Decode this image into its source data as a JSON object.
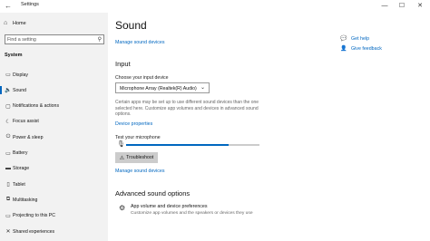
{
  "window": {
    "title": "Settings",
    "back_glyph": "←",
    "controls": {
      "minimize": "—",
      "maximize": "☐",
      "close": "✕"
    }
  },
  "sidebar": {
    "home_label": "Home",
    "search_placeholder": "Find a setting",
    "section_title": "System",
    "items": [
      {
        "label": "Display",
        "icon": "display-icon",
        "glyph": "▭",
        "active": false
      },
      {
        "label": "Sound",
        "icon": "speaker-icon",
        "glyph": "🔈",
        "active": true
      },
      {
        "label": "Notifications & actions",
        "icon": "notifications-icon",
        "glyph": "▢",
        "active": false
      },
      {
        "label": "Focus assist",
        "icon": "focus-assist-icon",
        "glyph": "☾",
        "active": false
      },
      {
        "label": "Power & sleep",
        "icon": "power-icon",
        "glyph": "⏻",
        "active": false
      },
      {
        "label": "Battery",
        "icon": "battery-icon",
        "glyph": "▭",
        "active": false
      },
      {
        "label": "Storage",
        "icon": "storage-icon",
        "glyph": "▬",
        "active": false
      },
      {
        "label": "Tablet",
        "icon": "tablet-icon",
        "glyph": "▯",
        "active": false
      },
      {
        "label": "Multitasking",
        "icon": "multitasking-icon",
        "glyph": "⧉",
        "active": false
      },
      {
        "label": "Projecting to this PC",
        "icon": "projecting-icon",
        "glyph": "▭",
        "active": false
      },
      {
        "label": "Shared experiences",
        "icon": "shared-experiences-icon",
        "glyph": "✕",
        "active": false
      }
    ]
  },
  "main": {
    "title": "Sound",
    "manage_sound_devices_top": "Manage sound devices",
    "input_heading": "Input",
    "choose_input_label": "Choose your input device",
    "input_device_selected": "Microphone Array (Realtek(R) Audio)",
    "input_description": "Certain apps may be set up to use different sound devices than the one selected here. Customize app volumes and devices in advanced sound options.",
    "device_properties_link": "Device properties",
    "test_mic_label": "Test your microphone",
    "mic_level_percent": 77,
    "troubleshoot_label": "Troubleshoot",
    "manage_sound_devices_bottom": "Manage sound devices",
    "advanced_heading": "Advanced sound options",
    "app_volume_title": "App volume and device preferences",
    "app_volume_desc": "Customize app volumes and the speakers or devices they use"
  },
  "side_links": {
    "get_help": "Get help",
    "give_feedback": "Give feedback"
  },
  "colors": {
    "accent": "#0067c0",
    "sidebar_bg": "#f2f2f2",
    "button_bg": "#cccccc"
  }
}
